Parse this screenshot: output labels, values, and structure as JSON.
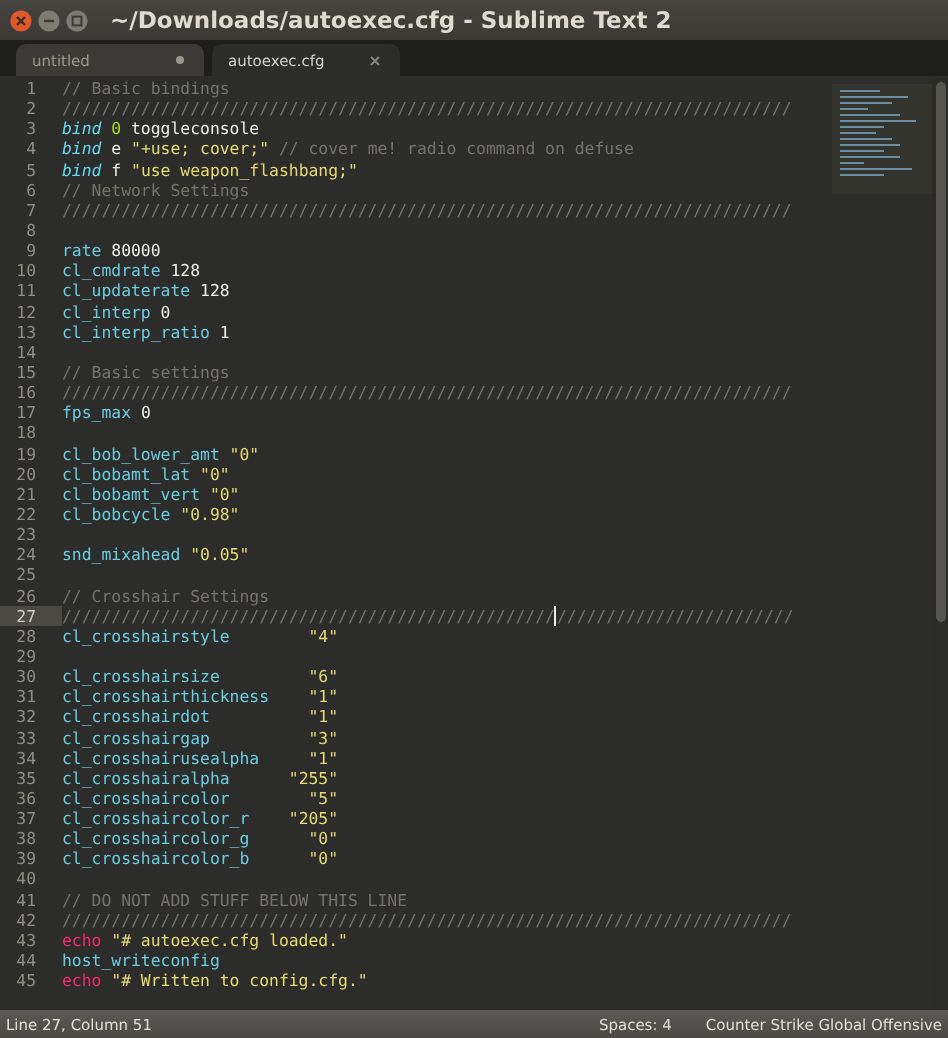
{
  "window": {
    "title": "~/Downloads/autoexec.cfg - Sublime Text 2"
  },
  "tabs": [
    {
      "label": "untitled",
      "selected": false,
      "modified": true
    },
    {
      "label": "autoexec.cfg",
      "selected": true,
      "modified": false
    }
  ],
  "editor": {
    "lines": [
      {
        "number": "1",
        "current": false,
        "tokens": [
          {
            "kind": "comment",
            "text": "// Basic bindings"
          }
        ]
      },
      {
        "number": "2",
        "current": false,
        "tokens": [
          {
            "kind": "comment",
            "text": "//////////////////////////////////////////////////////////////////////////"
          }
        ]
      },
      {
        "number": "3",
        "current": false,
        "tokens": [
          {
            "kind": "keyword",
            "text": "bind"
          },
          {
            "kind": "number",
            "text": " 0"
          },
          {
            "kind": "plain",
            "text": " toggleconsole"
          }
        ]
      },
      {
        "number": "4",
        "current": false,
        "tokens": [
          {
            "kind": "keyword",
            "text": "bind"
          },
          {
            "kind": "plain",
            "text": " e "
          },
          {
            "kind": "string",
            "text": "\"+use; cover;\""
          },
          {
            "kind": "comment",
            "text": " // cover me! radio command on defuse"
          }
        ]
      },
      {
        "number": "5",
        "current": false,
        "tokens": [
          {
            "kind": "keyword",
            "text": "bind"
          },
          {
            "kind": "plain",
            "text": " f "
          },
          {
            "kind": "string",
            "text": "\"use weapon_flashbang;\""
          }
        ]
      },
      {
        "number": "6",
        "current": false,
        "tokens": [
          {
            "kind": "comment",
            "text": "// Network Settings"
          }
        ]
      },
      {
        "number": "7",
        "current": false,
        "tokens": [
          {
            "kind": "comment",
            "text": "//////////////////////////////////////////////////////////////////////////"
          }
        ]
      },
      {
        "number": "8",
        "current": false
      },
      {
        "number": "9",
        "current": false,
        "tokens": [
          {
            "kind": "variable",
            "text": "rate"
          },
          {
            "kind": "plain",
            "text": " 80000"
          }
        ]
      },
      {
        "number": "10",
        "current": false,
        "tokens": [
          {
            "kind": "variable",
            "text": "cl_cmdrate"
          },
          {
            "kind": "plain",
            "text": " 128"
          }
        ]
      },
      {
        "number": "11",
        "current": false,
        "tokens": [
          {
            "kind": "variable",
            "text": "cl_updaterate"
          },
          {
            "kind": "plain",
            "text": " 128"
          }
        ]
      },
      {
        "number": "12",
        "current": false,
        "tokens": [
          {
            "kind": "variable",
            "text": "cl_interp"
          },
          {
            "kind": "plain",
            "text": " 0"
          }
        ]
      },
      {
        "number": "13",
        "current": false,
        "tokens": [
          {
            "kind": "variable",
            "text": "cl_interp_ratio"
          },
          {
            "kind": "plain",
            "text": " 1"
          }
        ]
      },
      {
        "number": "14",
        "current": false
      },
      {
        "number": "15",
        "current": false,
        "tokens": [
          {
            "kind": "comment",
            "text": "// Basic settings"
          }
        ]
      },
      {
        "number": "16",
        "current": false,
        "tokens": [
          {
            "kind": "comment",
            "text": "//////////////////////////////////////////////////////////////////////////"
          }
        ]
      },
      {
        "number": "17",
        "current": false,
        "tokens": [
          {
            "kind": "variable",
            "text": "fps_max"
          },
          {
            "kind": "plain",
            "text": " 0"
          }
        ]
      },
      {
        "number": "18",
        "current": false
      },
      {
        "number": "19",
        "current": false,
        "tokens": [
          {
            "kind": "variable",
            "text": "cl_bob_lower_amt"
          },
          {
            "kind": "string",
            "text": " \"0\""
          }
        ]
      },
      {
        "number": "20",
        "current": false,
        "tokens": [
          {
            "kind": "variable",
            "text": "cl_bobamt_lat"
          },
          {
            "kind": "string",
            "text": " \"0\""
          }
        ]
      },
      {
        "number": "21",
        "current": false,
        "tokens": [
          {
            "kind": "variable",
            "text": "cl_bobamt_vert"
          },
          {
            "kind": "string",
            "text": " \"0\""
          }
        ]
      },
      {
        "number": "22",
        "current": false,
        "tokens": [
          {
            "kind": "variable",
            "text": "cl_bobcycle"
          },
          {
            "kind": "string",
            "text": " \"0.98\""
          }
        ]
      },
      {
        "number": "23",
        "current": false
      },
      {
        "number": "24",
        "current": false,
        "tokens": [
          {
            "kind": "variable",
            "text": "snd_mixahead"
          },
          {
            "kind": "string",
            "text": " \"0.05\""
          }
        ]
      },
      {
        "number": "25",
        "current": false
      },
      {
        "number": "26",
        "current": false,
        "tokens": [
          {
            "kind": "comment",
            "text": "// Crosshair Settings"
          }
        ]
      },
      {
        "number": "27",
        "current": true,
        "tokens": [
          {
            "kind": "comment",
            "text": "//////////////////////////////////////////////////"
          },
          {
            "kind": "comment",
            "text": "////////////////////////",
            "caret": true
          }
        ]
      },
      {
        "number": "28",
        "current": false,
        "tokens": [
          {
            "kind": "variable",
            "text": "cl_crosshairstyle"
          },
          {
            "kind": "string",
            "text": "        \"4\""
          }
        ]
      },
      {
        "number": "29",
        "current": false
      },
      {
        "number": "30",
        "current": false,
        "tokens": [
          {
            "kind": "variable",
            "text": "cl_crosshairsize"
          },
          {
            "kind": "string",
            "text": "         \"6\""
          }
        ]
      },
      {
        "number": "31",
        "current": false,
        "tokens": [
          {
            "kind": "variable",
            "text": "cl_crosshairthickness"
          },
          {
            "kind": "string",
            "text": "    \"1\""
          }
        ]
      },
      {
        "number": "32",
        "current": false,
        "tokens": [
          {
            "kind": "variable",
            "text": "cl_crosshairdot"
          },
          {
            "kind": "string",
            "text": "          \"1\""
          }
        ]
      },
      {
        "number": "33",
        "current": false,
        "tokens": [
          {
            "kind": "variable",
            "text": "cl_crosshairgap"
          },
          {
            "kind": "string",
            "text": "          \"3\""
          }
        ]
      },
      {
        "number": "34",
        "current": false,
        "tokens": [
          {
            "kind": "variable",
            "text": "cl_crosshairusealpha"
          },
          {
            "kind": "string",
            "text": "     \"1\""
          }
        ]
      },
      {
        "number": "35",
        "current": false,
        "tokens": [
          {
            "kind": "variable",
            "text": "cl_crosshairalpha"
          },
          {
            "kind": "string",
            "text": "      \"255\""
          }
        ]
      },
      {
        "number": "36",
        "current": false,
        "tokens": [
          {
            "kind": "variable",
            "text": "cl_crosshaircolor"
          },
          {
            "kind": "string",
            "text": "        \"5\""
          }
        ]
      },
      {
        "number": "37",
        "current": false,
        "tokens": [
          {
            "kind": "variable",
            "text": "cl_crosshaircolor_r"
          },
          {
            "kind": "string",
            "text": "    \"205\""
          }
        ]
      },
      {
        "number": "38",
        "current": false,
        "tokens": [
          {
            "kind": "variable",
            "text": "cl_crosshaircolor_g"
          },
          {
            "kind": "string",
            "text": "      \"0\""
          }
        ]
      },
      {
        "number": "39",
        "current": false,
        "tokens": [
          {
            "kind": "variable",
            "text": "cl_crosshaircolor_b"
          },
          {
            "kind": "string",
            "text": "      \"0\""
          }
        ]
      },
      {
        "number": "40",
        "current": false
      },
      {
        "number": "41",
        "current": false,
        "tokens": [
          {
            "kind": "comment",
            "text": "// DO NOT ADD STUFF BELOW THIS LINE"
          }
        ]
      },
      {
        "number": "42",
        "current": false,
        "tokens": [
          {
            "kind": "comment",
            "text": "//////////////////////////////////////////////////////////////////////////"
          }
        ]
      },
      {
        "number": "43",
        "current": false,
        "tokens": [
          {
            "kind": "command",
            "text": "echo"
          },
          {
            "kind": "string",
            "text": " \"# autoexec.cfg loaded.\""
          }
        ]
      },
      {
        "number": "44",
        "current": false,
        "tokens": [
          {
            "kind": "variable",
            "text": "host_writeconfig"
          }
        ]
      },
      {
        "number": "45",
        "current": false,
        "tokens": [
          {
            "kind": "command",
            "text": "echo"
          },
          {
            "kind": "string",
            "text": " \"# Written to config.cfg.\""
          }
        ]
      }
    ]
  },
  "status_bar": {
    "position": "Line 27, Column 51",
    "indentation": "Spaces: 4",
    "syntax": "Counter Strike Global Offensive"
  }
}
